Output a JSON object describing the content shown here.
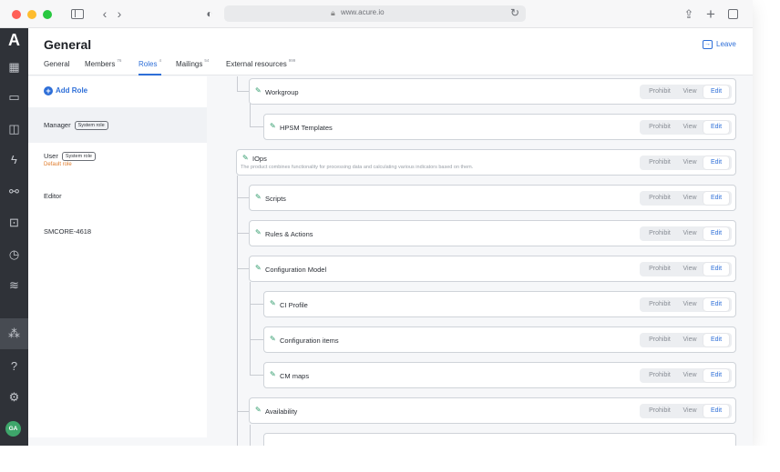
{
  "browser": {
    "url": "www.acure.io"
  },
  "app": {
    "logo": "A",
    "user_initials": "GA",
    "rail_icons": [
      "dashboard-icon",
      "clipboard-icon",
      "chart-icon",
      "lightning-icon",
      "workflow-icon",
      "grid-icon",
      "history-icon",
      "database-icon",
      "users-icon",
      "help-icon",
      "settings-icon"
    ]
  },
  "header": {
    "title": "General",
    "leave_label": "Leave",
    "tabs": [
      {
        "label": "General",
        "count": ""
      },
      {
        "label": "Members",
        "count": "76"
      },
      {
        "label": "Roles",
        "count": "4"
      },
      {
        "label": "Mailings",
        "count": "54"
      },
      {
        "label": "External resources",
        "count": "999"
      }
    ],
    "active_tab": "Roles"
  },
  "roles": {
    "add_label": "Add Role",
    "items": [
      {
        "name": "Manager",
        "badge": "System role",
        "sub": ""
      },
      {
        "name": "User",
        "badge": "System role",
        "sub": "Default role"
      },
      {
        "name": "Editor",
        "badge": "",
        "sub": ""
      },
      {
        "name": "SMCORE-4618",
        "badge": "",
        "sub": ""
      }
    ],
    "selected": "Manager"
  },
  "permission_options": {
    "prohibit": "Prohibit",
    "view": "View",
    "edit": "Edit"
  },
  "permissions": [
    {
      "name": "Workgroup",
      "level": "Edit"
    },
    {
      "name": "HPSM Templates",
      "level": "Edit"
    },
    {
      "name": "IOps",
      "description": "The product combines functionality for processing data and calculating various indicators based on them.",
      "level": "Edit"
    },
    {
      "name": "Scripts",
      "level": "Edit"
    },
    {
      "name": "Rules & Actions",
      "level": "Edit"
    },
    {
      "name": "Configuration Model",
      "level": "Edit"
    },
    {
      "name": "CI Profile",
      "level": "Edit"
    },
    {
      "name": "Configuration items",
      "level": "Edit"
    },
    {
      "name": "CM maps",
      "level": "Edit"
    },
    {
      "name": "Availability",
      "level": "Edit"
    }
  ],
  "colors": {
    "accent": "#2e6fd8",
    "edit_icon": "#2e9a6a",
    "rail": "#2f3238",
    "default_role": "#e07b2a"
  }
}
